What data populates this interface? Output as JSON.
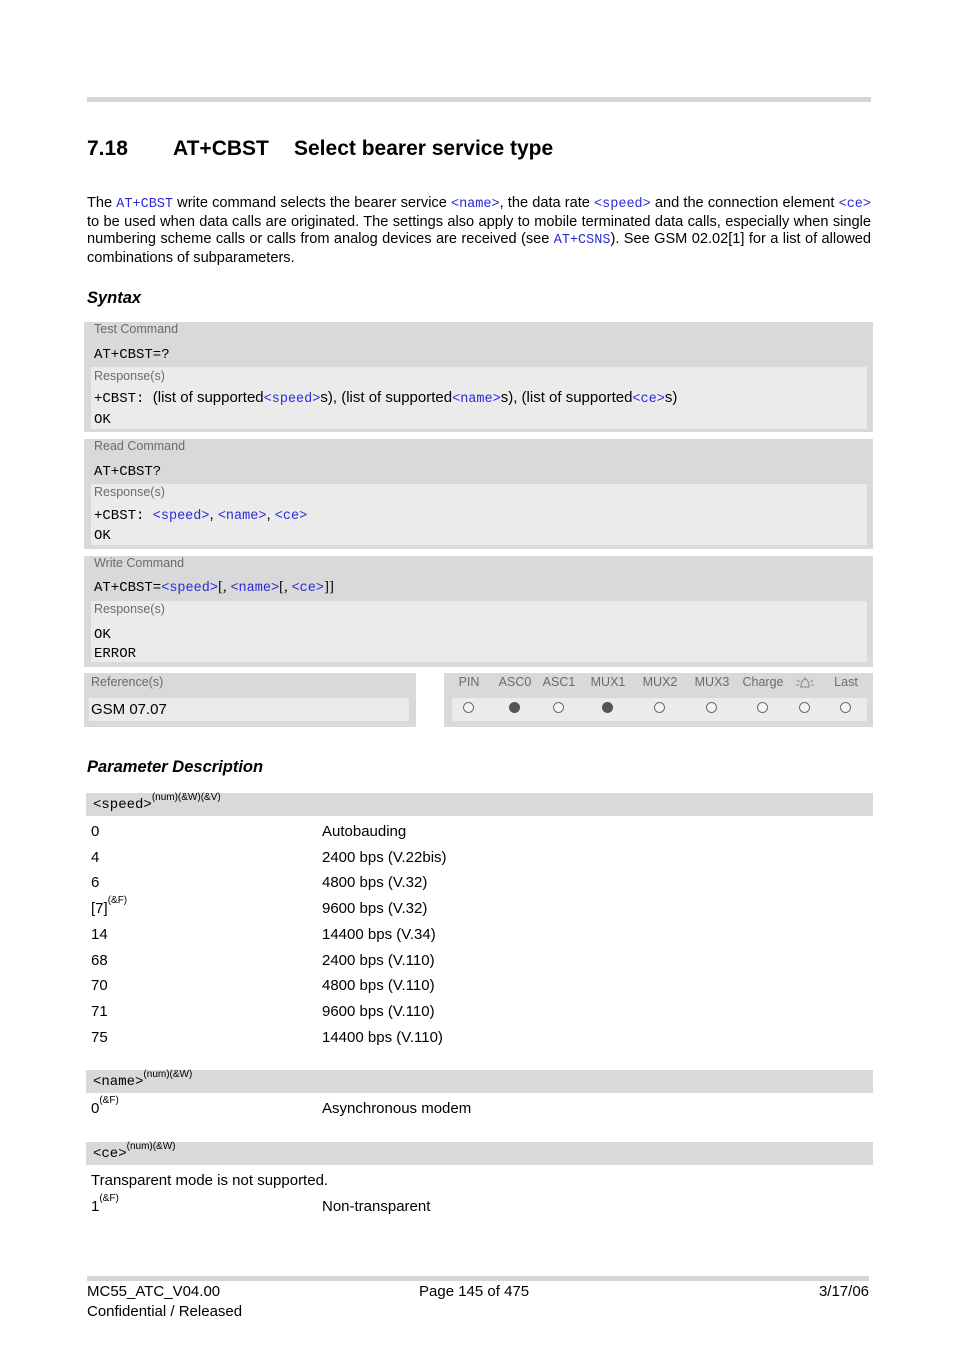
{
  "section": {
    "number": "7.18",
    "command": "AT+CBST",
    "title": "Select bearer service type"
  },
  "intro": {
    "p1": "The ",
    "link1": "AT+CBST",
    "p2": " write command selects the bearer service ",
    "param_name": "<name>",
    "p3": ", the data rate ",
    "param_speed": "<speed>",
    "p4": " and the connection element ",
    "param_ce": "<ce>",
    "p5": " to be used when data calls are originated. The settings also apply to mobile terminated data calls, especially when single numbering scheme calls or calls from analog devices are received (see ",
    "link2": "AT+CSNS",
    "p6": "). See GSM 02.02[1] for a list of allowed combinations of subparameters."
  },
  "syntax": {
    "heading": "Syntax",
    "test": {
      "label": "Test Command",
      "command": "AT+CBST=?",
      "response_label": "Response(s)",
      "resp_prefix": "+CBST:",
      "resp_t1": "(list of supported",
      "resp_speed": "<speed>",
      "resp_t2": "s), (list of supported",
      "resp_name": "<name>",
      "resp_t3": "s), (list of supported",
      "resp_ce": "<ce>",
      "resp_t4": "s)",
      "resp_ok": "OK"
    },
    "read": {
      "label": "Read Command",
      "command": "AT+CBST?",
      "response_label": "Response(s)",
      "resp_prefix": "+CBST:",
      "resp_speed": "<speed>",
      "sep1": ", ",
      "resp_name": "<name>",
      "sep2": ", ",
      "resp_ce": "<ce>",
      "resp_ok": "OK"
    },
    "write": {
      "label": "Write Command",
      "command_prefix": "AT+CBST=",
      "speed": "<speed>",
      "sep1": "[, ",
      "name": "<name>",
      "sep2": "[, ",
      "ce": "<ce>",
      "end": "]]",
      "response_label": "Response(s)",
      "resp_ok": "OK",
      "resp_error": "ERROR"
    },
    "reference": {
      "label": "Reference(s)",
      "value": "GSM 07.07"
    },
    "flags": [
      {
        "label": "PIN",
        "icon": null,
        "active": false
      },
      {
        "label": "ASC0",
        "icon": null,
        "active": true
      },
      {
        "label": "ASC1",
        "icon": null,
        "active": false
      },
      {
        "label": "MUX1",
        "icon": null,
        "active": true
      },
      {
        "label": "MUX2",
        "icon": null,
        "active": false
      },
      {
        "label": "MUX3",
        "icon": null,
        "active": false
      },
      {
        "label": "Charge",
        "icon": null,
        "active": false
      },
      {
        "label": "",
        "icon": "alarm-bell-icon",
        "active": false
      },
      {
        "label": "Last",
        "icon": null,
        "active": false
      }
    ]
  },
  "params": {
    "heading": "Parameter Description",
    "speed": {
      "name": "<speed>",
      "attrs": "(num)(&W)(&V)",
      "rows": [
        {
          "key": "0",
          "sup": "",
          "value": "Autobauding"
        },
        {
          "key": "4",
          "sup": "",
          "value": "2400 bps (V.22bis)"
        },
        {
          "key": "6",
          "sup": "",
          "value": "4800 bps (V.32)"
        },
        {
          "key": "[7]",
          "sup": "(&F)",
          "value": "9600 bps (V.32)"
        },
        {
          "key": "14",
          "sup": "",
          "value": "14400 bps (V.34)"
        },
        {
          "key": "68",
          "sup": "",
          "value": "2400 bps (V.110)"
        },
        {
          "key": "70",
          "sup": "",
          "value": "4800 bps (V.110)"
        },
        {
          "key": "71",
          "sup": "",
          "value": "9600 bps (V.110)"
        },
        {
          "key": "75",
          "sup": "",
          "value": "14400 bps (V.110)"
        }
      ]
    },
    "name": {
      "name": "<name>",
      "attrs": "(num)(&W)",
      "rows": [
        {
          "key": "0",
          "sup": "(&F)",
          "value": "Asynchronous modem"
        }
      ]
    },
    "ce": {
      "name": "<ce>",
      "attrs": "(num)(&W)",
      "note": "Transparent mode is not supported.",
      "rows": [
        {
          "key": "1",
          "sup": "(&F)",
          "value": "Non-transparent"
        }
      ]
    }
  },
  "footer": {
    "doc_id": "MC55_ATC_V04.00",
    "status": "Confidential / Released",
    "page": "Page 145 of 475",
    "date": "3/17/06"
  }
}
